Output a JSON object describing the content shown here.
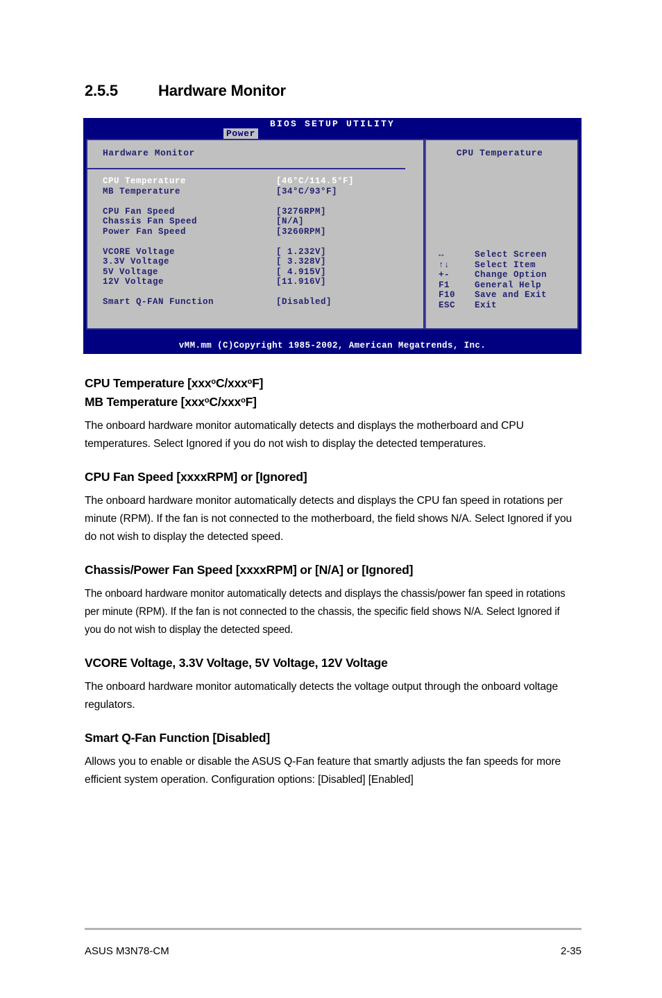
{
  "section": {
    "number": "2.5.5",
    "title": "Hardware Monitor"
  },
  "bios": {
    "title": "BIOS SETUP UTILITY",
    "tab": "Power",
    "panel_heading": "Hardware Monitor",
    "rows": [
      {
        "label": "CPU Temperature",
        "value": "[46°C/114.5°F]",
        "selected": true
      },
      {
        "label": "MB Temperature",
        "value": "[34°C/93°F]",
        "selected": false
      },
      {
        "label": "",
        "value": "",
        "selected": false
      },
      {
        "label": "CPU Fan Speed",
        "value": "[3276RPM]",
        "selected": false
      },
      {
        "label": "Chassis Fan Speed",
        "value": "[N/A]",
        "selected": false
      },
      {
        "label": "Power Fan Speed",
        "value": "[3260RPM]",
        "selected": false
      },
      {
        "label": "",
        "value": "",
        "selected": false
      },
      {
        "label": "VCORE Voltage",
        "value": "[ 1.232V]",
        "selected": false
      },
      {
        "label": "3.3V Voltage",
        "value": "[ 3.328V]",
        "selected": false
      },
      {
        "label": "5V Voltage",
        "value": "[ 4.915V]",
        "selected": false
      },
      {
        "label": "12V Voltage",
        "value": "[11.916V]",
        "selected": false
      },
      {
        "label": "",
        "value": "",
        "selected": false
      },
      {
        "label": "Smart Q-FAN Function",
        "value": "[Disabled]",
        "selected": false
      }
    ],
    "help_title": "CPU Temperature",
    "keys": [
      {
        "key": "↔",
        "desc": "Select Screen"
      },
      {
        "key": "↑↓",
        "desc": "Select Item"
      },
      {
        "key": "+-",
        "desc": "Change Option"
      },
      {
        "key": "F1",
        "desc": "General Help"
      },
      {
        "key": "F10",
        "desc": "Save and Exit"
      },
      {
        "key": "ESC",
        "desc": "Exit"
      }
    ],
    "footer": "vMM.mm (C)Copyright 1985-2002, American Megatrends, Inc.",
    "colors": {
      "header_blue": "#000080",
      "panel_gray": "#c0c0c0",
      "text_blue": "#232370",
      "selected_white": "#ffffff",
      "border_blue": "#2b2b8f"
    }
  },
  "items": [
    {
      "heading_parts": [
        "CPU Temperature [xxx",
        "C/xxx",
        "F]"
      ],
      "heading2_parts": [
        "MB Temperature [xxx",
        "C/xxx",
        "F]"
      ],
      "body": "The onboard hardware monitor automatically detects and displays the motherboard and CPU temperatures. Select Ignored if you do not wish to display the detected temperatures."
    },
    {
      "heading": "CPU Fan Speed [xxxxRPM] or [Ignored]",
      "body": "The onboard hardware monitor automatically detects and displays the CPU fan speed in rotations per minute (RPM). If the fan is not connected to the motherboard, the field shows N/A. Select Ignored if you do not wish to display the detected speed."
    },
    {
      "heading": "Chassis/Power Fan Speed [xxxxRPM] or [N/A] or [Ignored]",
      "body": "The onboard hardware monitor automatically detects and displays the chassis/power fan speed in rotations per minute (RPM). If the fan is not connected to the chassis, the specific field shows N/A. Select Ignored if you do not wish to display the detected speed."
    },
    {
      "heading": "VCORE Voltage, 3.3V Voltage, 5V Voltage, 12V Voltage",
      "body": "The onboard hardware monitor automatically detects the voltage output through the onboard voltage regulators."
    },
    {
      "heading": "Smart Q-Fan Function [Disabled]",
      "body": "Allows you to enable or disable the ASUS Q-Fan feature that smartly adjusts the fan speeds for more efficient system operation. Configuration options: [Disabled] [Enabled]"
    }
  ],
  "page_footer": {
    "left": "ASUS M3N78-CM",
    "right": "2-35"
  }
}
